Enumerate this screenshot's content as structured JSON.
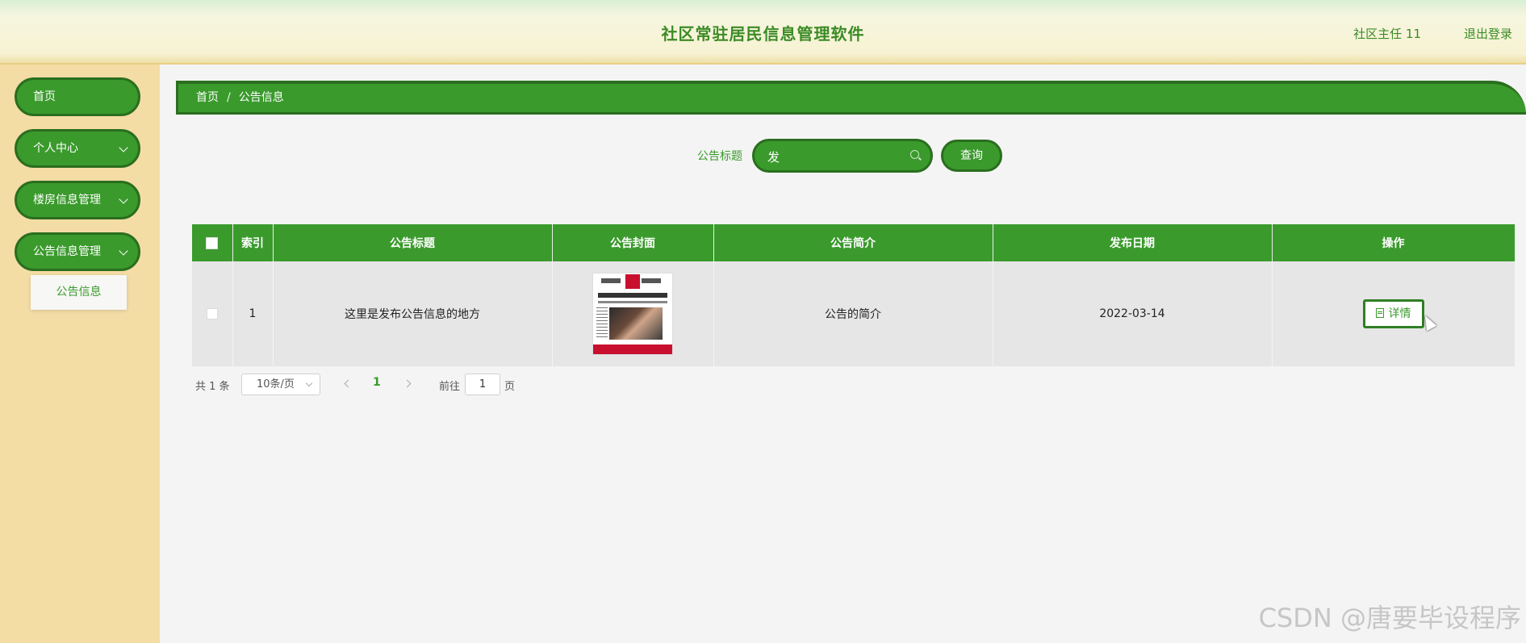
{
  "header": {
    "title": "社区常驻居民信息管理软件",
    "user": "社区主任 11",
    "logout": "退出登录"
  },
  "sidebar": {
    "items": [
      {
        "label": "首页"
      },
      {
        "label": "个人中心"
      },
      {
        "label": "楼房信息管理"
      },
      {
        "label": "公告信息管理"
      }
    ],
    "submenu": {
      "label": "公告信息"
    }
  },
  "breadcrumb": {
    "home": "首页",
    "separator": "/",
    "current": "公告信息"
  },
  "search": {
    "label": "公告标题",
    "value": "发",
    "button": "查询"
  },
  "table": {
    "columns": [
      "索引",
      "公告标题",
      "公告封面",
      "公告简介",
      "发布日期",
      "操作"
    ],
    "rows": [
      {
        "index": "1",
        "title": "这里是发布公告信息的地方",
        "intro": "公告的简介",
        "date": "2022-03-14",
        "action": "详情"
      }
    ]
  },
  "pagination": {
    "total": "共 1 条",
    "page_size": "10条/页",
    "current_page": "1",
    "goto_label": "前往",
    "goto_value": "1",
    "page_suffix": "页"
  },
  "watermark": "CSDN @唐要毕设程序",
  "colors": {
    "primary": "#3a9a2c",
    "primary_dark": "#2a6e1f",
    "sidebar_bg": "#f4dca5"
  }
}
